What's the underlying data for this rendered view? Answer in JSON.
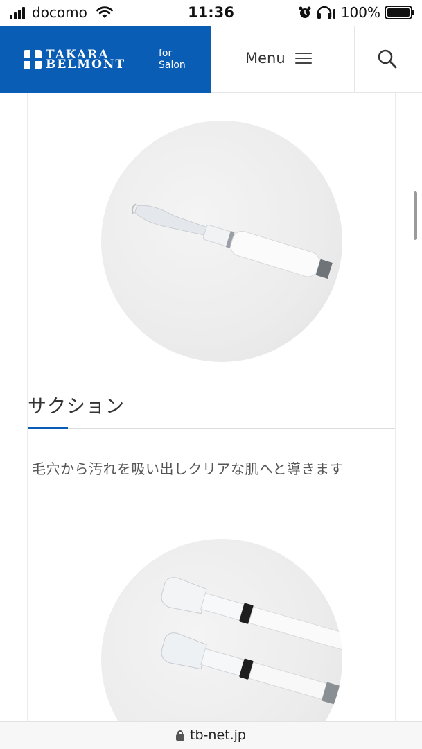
{
  "status_bar": {
    "carrier": "docomo",
    "time": "11:36",
    "battery": "100%",
    "icons": [
      "signal-icon",
      "wifi-icon",
      "alarm-icon",
      "headphones-icon",
      "battery-icon"
    ]
  },
  "header": {
    "logo_line1": "TAKARA",
    "logo_line2": "BELMONT",
    "tagline_line1": "for",
    "tagline_line2": "Salon",
    "menu_label": "Menu",
    "search_icon": "search-icon",
    "brand_color": "#0a5db5"
  },
  "product": {
    "title": "サクション",
    "description": "毛穴から汚れを吸い出しクリアな肌へと導きます"
  },
  "browser": {
    "url": "tb-net.jp"
  }
}
